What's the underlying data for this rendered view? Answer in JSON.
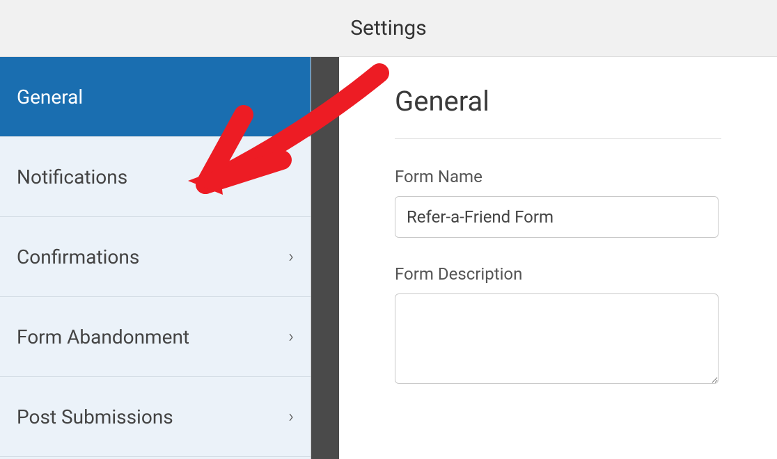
{
  "header": {
    "title": "Settings"
  },
  "sidebar": {
    "items": [
      {
        "label": "General",
        "has_chevron": false
      },
      {
        "label": "Notifications",
        "has_chevron": false
      },
      {
        "label": "Confirmations",
        "has_chevron": true
      },
      {
        "label": "Form Abandonment",
        "has_chevron": true
      },
      {
        "label": "Post Submissions",
        "has_chevron": true
      }
    ]
  },
  "main": {
    "title": "General",
    "form_name_label": "Form Name",
    "form_name_value": "Refer-a-Friend Form",
    "form_description_label": "Form Description",
    "form_description_value": ""
  },
  "annotation": {
    "arrow_color": "#ed1c24"
  }
}
